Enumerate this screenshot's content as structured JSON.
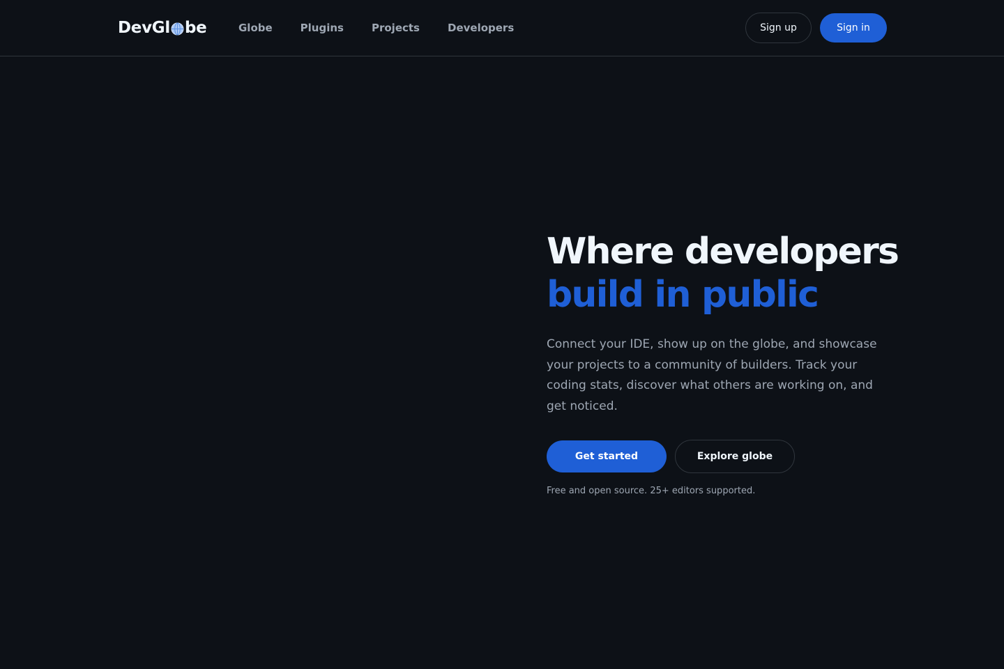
{
  "header": {
    "logo": {
      "prefix": "DevGl",
      "suffix": "be",
      "icon": "globe-icon"
    },
    "nav": [
      {
        "label": "Globe"
      },
      {
        "label": "Plugins"
      },
      {
        "label": "Projects"
      },
      {
        "label": "Developers"
      }
    ],
    "sign_up_label": "Sign up",
    "sign_in_label": "Sign in"
  },
  "hero": {
    "title_line1": "Where developers",
    "title_line2": "build in public",
    "description": "Connect your IDE, show up on the globe, and showcase your projects to a community of builders. Track your coding stats, discover what others are working on, and get noticed.",
    "primary_cta": "Get started",
    "secondary_cta": "Explore globe",
    "note": "Free and open source. 25+ editors supported."
  },
  "colors": {
    "background": "#0d1117",
    "accent": "#1f5fd6",
    "text_primary": "#f0f6fc",
    "text_muted": "#9ea7b3",
    "border": "#30363d"
  }
}
